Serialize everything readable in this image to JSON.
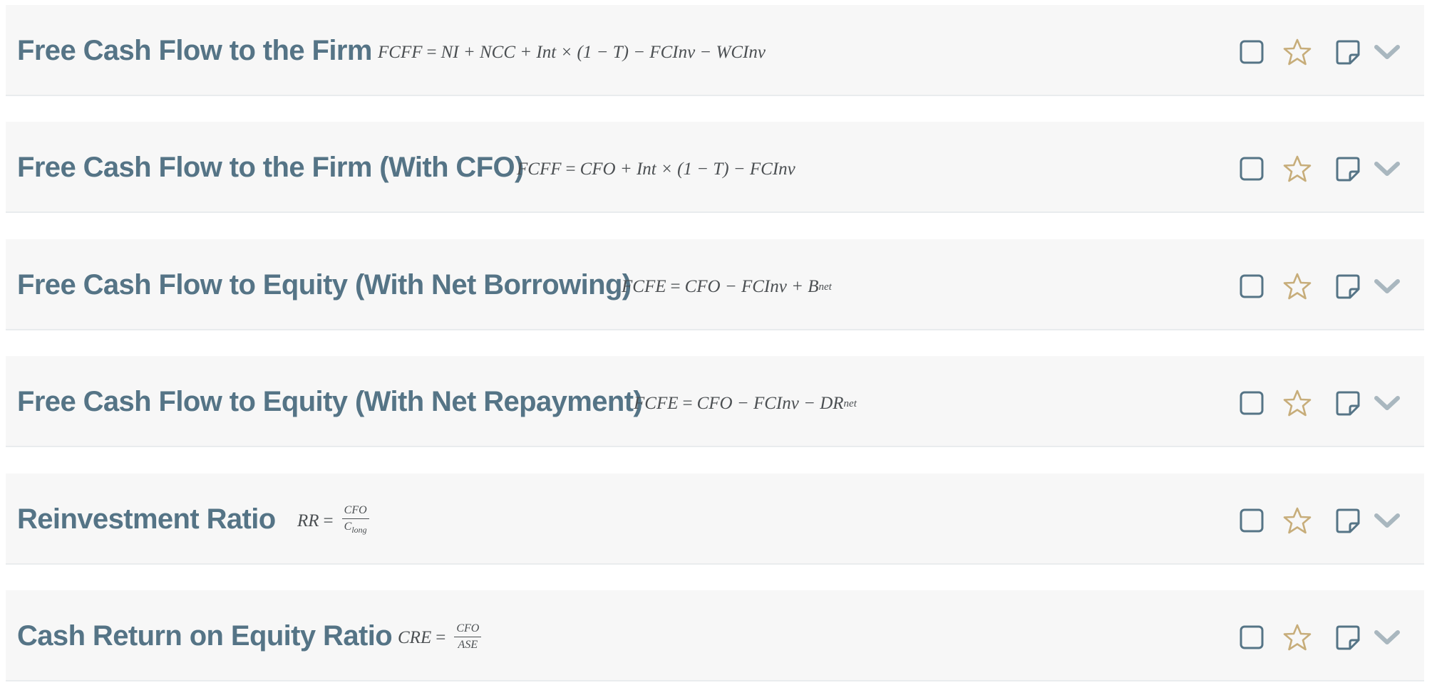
{
  "colors": {
    "card_background": "#f7f7f7",
    "title": "#557486",
    "formula": "#4b4f52",
    "checkbox_icon": "#557486",
    "star_icon": "#c7ad7a",
    "note_icon": "#557486",
    "chevron_icon": "#a9b7bf"
  },
  "formulas": [
    {
      "title": "Free Cash Flow to the Firm",
      "lhs": "FCFF",
      "eq": "=",
      "rhs": "NI + NCC + Int × (1 − T) − FCInv − WCInv",
      "icons": [
        "checkbox-icon",
        "star-icon",
        "note-icon",
        "chevron-down-icon"
      ]
    },
    {
      "title": "Free Cash Flow to the Firm (With CFO)",
      "lhs": "FCFF",
      "eq": "=",
      "rhs": "CFO + Int × (1 − T) − FCInv",
      "icons": [
        "checkbox-icon",
        "star-icon",
        "note-icon",
        "chevron-down-icon"
      ]
    },
    {
      "title": "Free Cash Flow to Equity (With Net Borrowing)",
      "lhs": "FCFE",
      "eq": "=",
      "rhs": "CFO − FCInv + B",
      "sub": "net",
      "icons": [
        "checkbox-icon",
        "star-icon",
        "note-icon",
        "chevron-down-icon"
      ]
    },
    {
      "title": "Free Cash Flow to Equity (With Net Repayment)",
      "lhs": "FCFE",
      "eq": "=",
      "rhs": "CFO − FCInv − DR",
      "sub": "net",
      "icons": [
        "checkbox-icon",
        "star-icon",
        "note-icon",
        "chevron-down-icon"
      ]
    },
    {
      "title": "Reinvestment Ratio",
      "lhs": "RR",
      "eq": "=",
      "num": "CFO",
      "den": "C",
      "den_sub": "long",
      "icons": [
        "checkbox-icon",
        "star-icon",
        "note-icon",
        "chevron-down-icon"
      ]
    },
    {
      "title": "Cash Return on Equity Ratio",
      "lhs": "CRE",
      "eq": "=",
      "num": "CFO",
      "den": "ASE",
      "icons": [
        "checkbox-icon",
        "star-icon",
        "note-icon",
        "chevron-down-icon"
      ]
    }
  ]
}
